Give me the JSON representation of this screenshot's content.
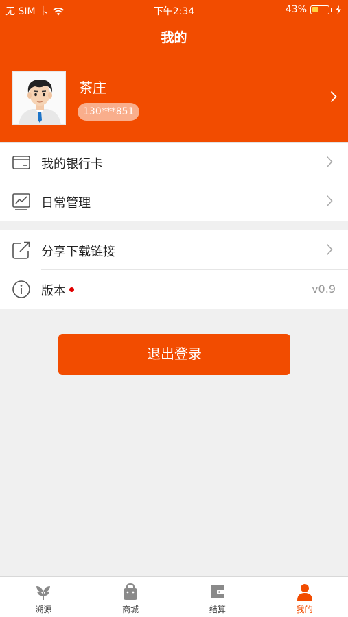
{
  "status_bar": {
    "carrier": "无 SIM 卡",
    "time": "下午2:34",
    "battery": "43%",
    "battery_level": 0.43
  },
  "header": {
    "title": "我的"
  },
  "profile": {
    "name": "茶庄",
    "phone": "130***851"
  },
  "menu_group_1": [
    {
      "label": "我的银行卡",
      "icon": "bank-card-icon"
    },
    {
      "label": "日常管理",
      "icon": "chart-icon"
    }
  ],
  "menu_group_2": [
    {
      "label": "分享下载链接",
      "icon": "share-icon"
    },
    {
      "label": "版本",
      "icon": "info-icon",
      "value": "v0.9",
      "has_badge": true
    }
  ],
  "logout_label": "退出登录",
  "tabbar": [
    {
      "label": "溯源",
      "icon": "leaf-icon",
      "active": false
    },
    {
      "label": "商城",
      "icon": "shopping-bag-icon",
      "active": false
    },
    {
      "label": "结算",
      "icon": "wallet-icon",
      "active": false
    },
    {
      "label": "我的",
      "icon": "person-icon",
      "active": true
    }
  ],
  "colors": {
    "accent": "#f24c00",
    "background": "#f0f0f0",
    "inactive_icon": "#8a8a8a",
    "badge": "#e00000"
  }
}
